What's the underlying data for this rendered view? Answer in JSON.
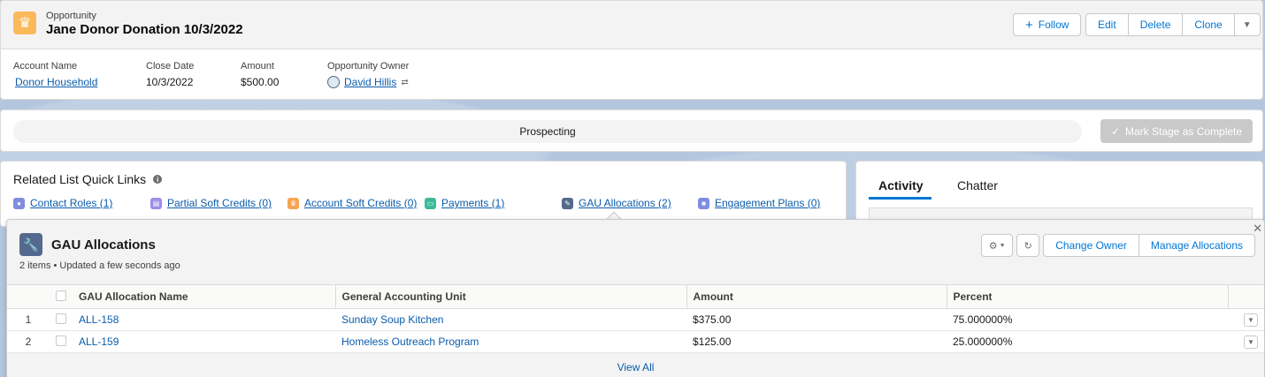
{
  "header": {
    "object_label": "Opportunity",
    "title": "Jane Donor Donation 10/3/2022",
    "buttons": {
      "follow": "Follow",
      "edit": "Edit",
      "delete": "Delete",
      "clone": "Clone"
    },
    "fields": {
      "account_name_label": "Account Name",
      "account_name_value": "Donor Household",
      "close_date_label": "Close Date",
      "close_date_value": "10/3/2022",
      "amount_label": "Amount",
      "amount_value": "$500.00",
      "owner_label": "Opportunity Owner",
      "owner_value": "David Hillis"
    }
  },
  "path": {
    "current_stage": "Prospecting",
    "mark_complete_label": "Mark Stage as Complete"
  },
  "related": {
    "title": "Related List Quick Links",
    "links": [
      {
        "label": "Contact Roles (1)",
        "color": "#7f8de1"
      },
      {
        "label": "Partial Soft Credits (0)",
        "color": "#9c8ee8"
      },
      {
        "label": "Account Soft Credits (0)",
        "color": "#f7a452"
      },
      {
        "label": "Payments (1)",
        "color": "#3bba9c"
      },
      {
        "label": "GAU Allocations (2)",
        "color": "#54698d"
      },
      {
        "label": "Engagement Plans (0)",
        "color": "#7f8de1"
      }
    ]
  },
  "activity": {
    "tabs": [
      "Activity",
      "Chatter"
    ]
  },
  "gau": {
    "title": "GAU Allocations",
    "subtitle": "2 items • Updated a few seconds ago",
    "buttons": {
      "change_owner": "Change Owner",
      "manage_allocations": "Manage Allocations"
    },
    "columns": [
      "GAU Allocation Name",
      "General Accounting Unit",
      "Amount",
      "Percent"
    ],
    "rows": [
      {
        "num": "1",
        "name": "ALL-158",
        "unit": "Sunday Soup Kitchen",
        "amount": "$375.00",
        "percent": "75.000000%"
      },
      {
        "num": "2",
        "name": "ALL-159",
        "unit": "Homeless Outreach Program",
        "amount": "$125.00",
        "percent": "25.000000%"
      }
    ],
    "view_all": "View All"
  }
}
